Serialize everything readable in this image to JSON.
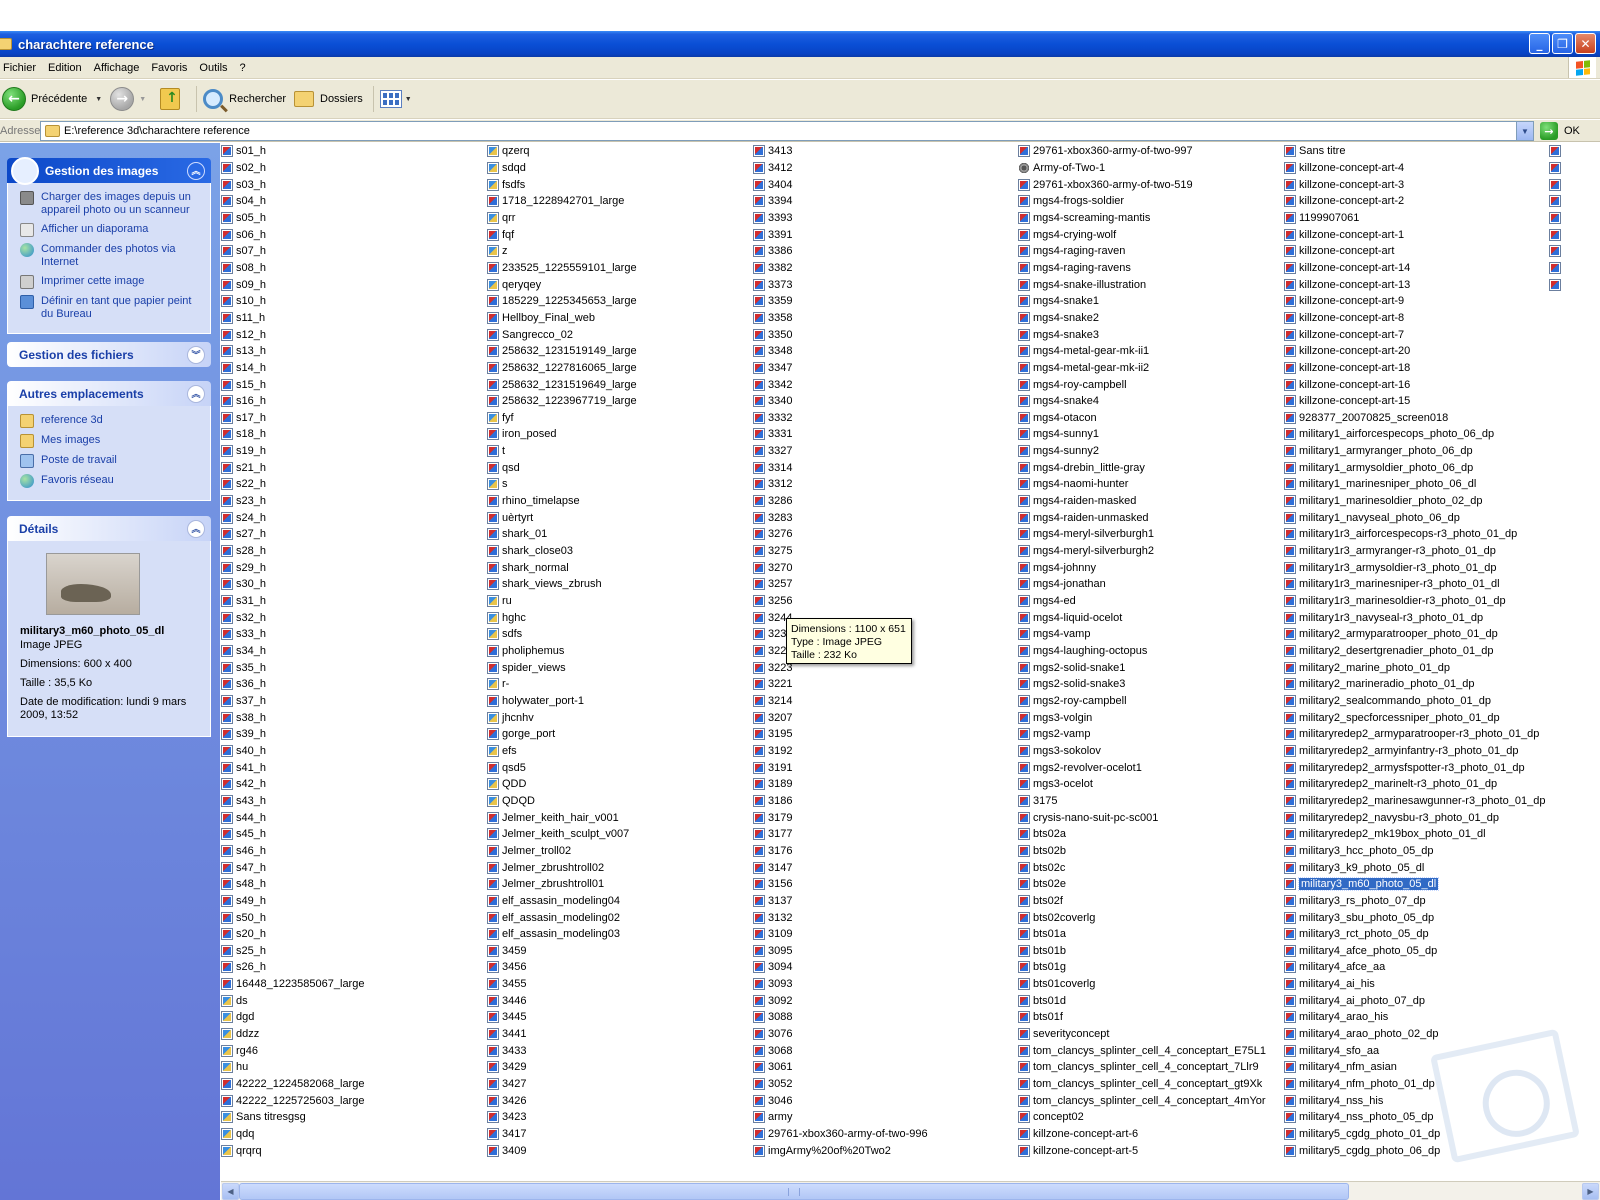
{
  "window": {
    "title": "charachtere reference"
  },
  "menu": [
    "Fichier",
    "Edition",
    "Affichage",
    "Favoris",
    "Outils",
    "?"
  ],
  "toolbar": {
    "back": "Précédente",
    "search": "Rechercher",
    "folders": "Dossiers"
  },
  "address": {
    "label": "Adresse",
    "path": "E:\\reference 3d\\charachtere reference",
    "go": "OK"
  },
  "taskpane": {
    "images": {
      "title": "Gestion des images",
      "tasks": [
        "Charger des images depuis un appareil photo ou un scanneur",
        "Afficher un diaporama",
        "Commander des photos via Internet",
        "Imprimer cette image",
        "Définir en tant que papier peint du Bureau"
      ]
    },
    "files": {
      "title": "Gestion des fichiers"
    },
    "places": {
      "title": "Autres emplacements",
      "items": [
        "reference 3d",
        "Mes images",
        "Poste de travail",
        "Favoris réseau"
      ]
    },
    "details": {
      "title": "Détails",
      "name": "military3_m60_photo_05_dl",
      "type": "Image JPEG",
      "dimensions": "Dimensions: 600 x 400",
      "size": "Taille : 35,5 Ko",
      "modified": "Date de modification: lundi 9 mars 2009, 13:52"
    }
  },
  "tooltip": {
    "dimensions": "Dimensions : 1100 x 651",
    "type": "Type : Image JPEG",
    "size": "Taille  : 232 Ko"
  },
  "files": {
    "col1": [
      "s01_h",
      "s02_h",
      "s03_h",
      "s04_h",
      "s05_h",
      "s06_h",
      "s07_h",
      "s08_h",
      "s09_h",
      "s10_h",
      "s11_h",
      "s12_h",
      "s13_h",
      "s14_h",
      "s15_h",
      "s16_h",
      "s17_h",
      "s18_h",
      "s19_h",
      "s21_h",
      "s22_h",
      "s23_h",
      "s24_h",
      "s27_h",
      "s28_h",
      "s29_h",
      "s30_h",
      "s31_h",
      "s32_h",
      "s33_h",
      "s34_h",
      "s35_h",
      "s36_h",
      "s37_h",
      "s38_h",
      "s39_h",
      "s40_h",
      "s41_h",
      "s42_h",
      "s43_h",
      "s44_h",
      "s45_h",
      "s46_h",
      "s47_h",
      "s48_h",
      "s49_h",
      "s50_h",
      "s20_h",
      "s25_h",
      "s26_h",
      "16448_1223585067_large",
      "ds",
      "dgd",
      "ddzz",
      "rg46",
      "hu",
      "42222_1224582068_large",
      "42222_1225725603_large",
      "Sans titresgsg",
      "qdq",
      "qrqrq"
    ],
    "col2": [
      "qzerq",
      "sdqd",
      "fsdfs",
      "1718_1228942701_large",
      "qrr",
      "fqf",
      "z",
      "233525_1225559101_large",
      "qeryqey",
      "185229_1225345653_large",
      "Hellboy_Final_web",
      "Sangrecco_02",
      "258632_1231519149_large",
      "258632_1227816065_large",
      "258632_1231519649_large",
      "258632_1223967719_large",
      "fyf",
      "iron_posed",
      "t",
      "qsd",
      "s",
      "rhino_timelapse",
      "uèrtyrt",
      "shark_01",
      "shark_close03",
      "shark_normal",
      "shark_views_zbrush",
      "ru",
      "hghc",
      "sdfs",
      "pholiphemus",
      "spider_views",
      "r-",
      "holywater_port-1",
      "jhcnhv",
      "gorge_port",
      "efs",
      "qsd5",
      "QDD",
      "QDQD",
      "Jelmer_keith_hair_v001",
      "Jelmer_keith_sculpt_v007",
      "Jelmer_troll02",
      "Jelmer_zbrushtroll02",
      "Jelmer_zbrushtroll01",
      "elf_assasin_modeling04",
      "elf_assasin_modeling02",
      "elf_assasin_modeling03",
      "3459",
      "3456",
      "3455",
      "3446",
      "3445",
      "3441",
      "3433",
      "3429",
      "3427",
      "3426",
      "3423",
      "3417",
      "3409"
    ],
    "col3": [
      "3413",
      "3412",
      "3404",
      "3394",
      "3393",
      "3391",
      "3386",
      "3382",
      "3373",
      "3359",
      "3358",
      "3350",
      "3348",
      "3347",
      "3342",
      "3340",
      "3332",
      "3331",
      "3327",
      "3314",
      "3312",
      "3286",
      "3283",
      "3276",
      "3275",
      "3270",
      "3257",
      "3256",
      "3244",
      "3237",
      "3226",
      "3223",
      "3221",
      "3214",
      "3207",
      "3195",
      "3192",
      "3191",
      "3189",
      "3186",
      "3179",
      "3177",
      "3176",
      "3147",
      "3156",
      "3137",
      "3132",
      "3109",
      "3095",
      "3094",
      "3093",
      "3092",
      "3088",
      "3076",
      "3068",
      "3061",
      "3052",
      "3046",
      "army",
      "29761-xbox360-army-of-two-996",
      "imgArmy%20of%20Two2"
    ],
    "col4": [
      "29761-xbox360-army-of-two-997",
      "Army-of-Two-1",
      "29761-xbox360-army-of-two-519",
      "mgs4-frogs-soldier",
      "mgs4-screaming-mantis",
      "mgs4-crying-wolf",
      "mgs4-raging-raven",
      "mgs4-raging-ravens",
      "mgs4-snake-illustration",
      "mgs4-snake1",
      "mgs4-snake2",
      "mgs4-snake3",
      "mgs4-metal-gear-mk-ii1",
      "mgs4-metal-gear-mk-ii2",
      "mgs4-roy-campbell",
      "mgs4-snake4",
      "mgs4-otacon",
      "mgs4-sunny1",
      "mgs4-sunny2",
      "mgs4-drebin_little-gray",
      "mgs4-naomi-hunter",
      "mgs4-raiden-masked",
      "mgs4-raiden-unmasked",
      "mgs4-meryl-silverburgh1",
      "mgs4-meryl-silverburgh2",
      "mgs4-johnny",
      "mgs4-jonathan",
      "mgs4-ed",
      "mgs4-liquid-ocelot",
      "mgs4-vamp",
      "mgs4-laughing-octopus",
      "mgs2-solid-snake1",
      "mgs2-solid-snake3",
      "mgs2-roy-campbell",
      "mgs3-volgin",
      "mgs2-vamp",
      "mgs3-sokolov",
      "mgs2-revolver-ocelot1",
      "mgs3-ocelot",
      "3175",
      "crysis-nano-suit-pc-sc001",
      "bts02a",
      "bts02b",
      "bts02c",
      "bts02e",
      "bts02f",
      "bts02coverlg",
      "bts01a",
      "bts01b",
      "bts01g",
      "bts01coverlg",
      "bts01d",
      "bts01f",
      "severityconcept",
      "tom_clancys_splinter_cell_4_conceptart_E75L1",
      "tom_clancys_splinter_cell_4_conceptart_7Llr9",
      "tom_clancys_splinter_cell_4_conceptart_gt9Xk",
      "tom_clancys_splinter_cell_4_conceptart_4mYor",
      "concept02",
      "killzone-concept-art-6",
      "killzone-concept-art-5"
    ],
    "col5": [
      "Sans titre",
      "killzone-concept-art-4",
      "killzone-concept-art-3",
      "killzone-concept-art-2",
      "1199907061",
      "killzone-concept-art-1",
      "killzone-concept-art",
      "killzone-concept-art-14",
      "killzone-concept-art-13",
      "killzone-concept-art-9",
      "killzone-concept-art-8",
      "killzone-concept-art-7",
      "killzone-concept-art-20",
      "killzone-concept-art-18",
      "killzone-concept-art-16",
      "killzone-concept-art-15",
      "928377_20070825_screen018",
      "military1_airforcespecops_photo_06_dp",
      "military1_armyranger_photo_06_dp",
      "military1_armysoldier_photo_06_dp",
      "military1_marinesniper_photo_06_dl",
      "military1_marinesoldier_photo_02_dp",
      "military1_navyseal_photo_06_dp",
      "military1r3_airforcespecops-r3_photo_01_dp",
      "military1r3_armyranger-r3_photo_01_dp",
      "military1r3_armysoldier-r3_photo_01_dp",
      "military1r3_marinesniper-r3_photo_01_dl",
      "military1r3_marinesoldier-r3_photo_01_dp",
      "military1r3_navyseal-r3_photo_01_dp",
      "military2_armyparatrooper_photo_01_dp",
      "military2_desertgrenadier_photo_01_dp",
      "military2_marine_photo_01_dp",
      "military2_marineradio_photo_01_dp",
      "military2_sealcommando_photo_01_dp",
      "military2_specforcessniper_photo_01_dp",
      "militaryredep2_armyparatrooper-r3_photo_01_dp",
      "militaryredep2_armyinfantry-r3_photo_01_dp",
      "militaryredep2_armysfspotter-r3_photo_01_dp",
      "militaryredep2_marinelt-r3_photo_01_dp",
      "militaryredep2_marinesawgunner-r3_photo_01_dp",
      "militaryredep2_navysbu-r3_photo_01_dp",
      "militaryredep2_mk19box_photo_01_dl",
      "military3_hcc_photo_05_dp",
      "military3_k9_photo_05_dl",
      "military3_m60_photo_05_dl",
      "military3_rs_photo_07_dp",
      "military3_sbu_photo_05_dp",
      "military3_rct_photo_05_dp",
      "military4_afce_photo_05_dp",
      "military4_afce_aa",
      "military4_ai_his",
      "military4_ai_photo_07_dp",
      "military4_arao_his",
      "military4_arao_photo_02_dp",
      "military4_sfo_aa",
      "military4_nfm_asian",
      "military4_nfm_photo_01_dp",
      "military4_nss_his",
      "military4_nss_photo_05_dp",
      "military5_cgdg_photo_01_dp",
      "military5_cgdg_photo_06_dp"
    ]
  },
  "icons": {
    "col1_png": [
      51,
      52,
      53,
      54,
      55,
      58,
      59,
      60
    ],
    "col2_png": [
      0,
      1,
      2,
      4,
      6,
      8,
      16,
      20,
      27,
      28,
      29,
      32,
      34,
      36,
      38,
      39
    ],
    "col4_ani": [
      1
    ],
    "selected": "military3_m60_photo_05_dl"
  }
}
